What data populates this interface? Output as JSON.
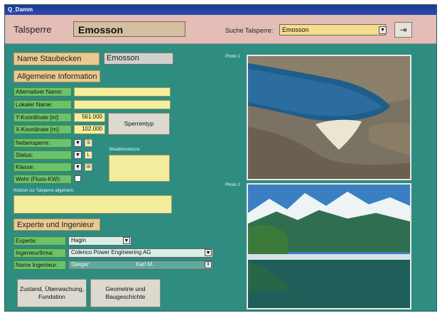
{
  "window": {
    "title": "Q_Damm"
  },
  "header": {
    "dam_label": "Talsperre",
    "dam_name": "Emosson",
    "search_label": "Suche Talsperre:",
    "search_value": "Emosson"
  },
  "basin": {
    "label": "Name Staubecken",
    "value": "Emosson"
  },
  "general": {
    "heading": "Allgemeine Information",
    "alt_name_label": "Alternativer Name:",
    "alt_name_value": "",
    "local_name_label": "Lokaler Name:",
    "local_name_value": "",
    "y_coord_label": "Y-Koordinate [m]:",
    "y_coord_value": "561.000",
    "x_coord_label": "X-Koordinate [m]:",
    "x_coord_value": "102.000",
    "dam_type_button": "Sperrentyp",
    "secondary_dam_label": "Nebensperre:",
    "secondary_dam_value": "S",
    "status_label": "Status:",
    "status_value": "L",
    "class_label": "Klasse:",
    "class_value": "III",
    "weir_label": "Wehr (Fluss-KW):",
    "sketch_label": "Situationsskizze:",
    "notes_label": "Notizen zur Talsperre allgemein:",
    "notes_value": ""
  },
  "experts": {
    "heading": "Experte und Ingenieur",
    "expert_label": "Experte:",
    "expert_value": "Hagin",
    "firm_label": "Ingenieurfirma:",
    "firm_value": "Colenco Power Engineering AG",
    "engineer_label": "Name Ingenieur:",
    "engineer_last": "Steiger",
    "engineer_first": "Karl M."
  },
  "buttons": {
    "condition": "Zustand, Überwachung, Fundation",
    "geometry": "Geometrie und Baugeschichte"
  },
  "photos": {
    "photo1_label": "Photo 1",
    "photo2_label": "Photo 2"
  },
  "icons": {
    "dropdown": "chevron-down-icon",
    "exit": "exit-door-icon",
    "spin": "spin-updown-icon"
  },
  "colors": {
    "background": "#2f8c80",
    "header": "#e3bdb6",
    "label_tan": "#e9c98f",
    "label_green": "#6cc26a",
    "field_yellow": "#f5ef9e"
  }
}
